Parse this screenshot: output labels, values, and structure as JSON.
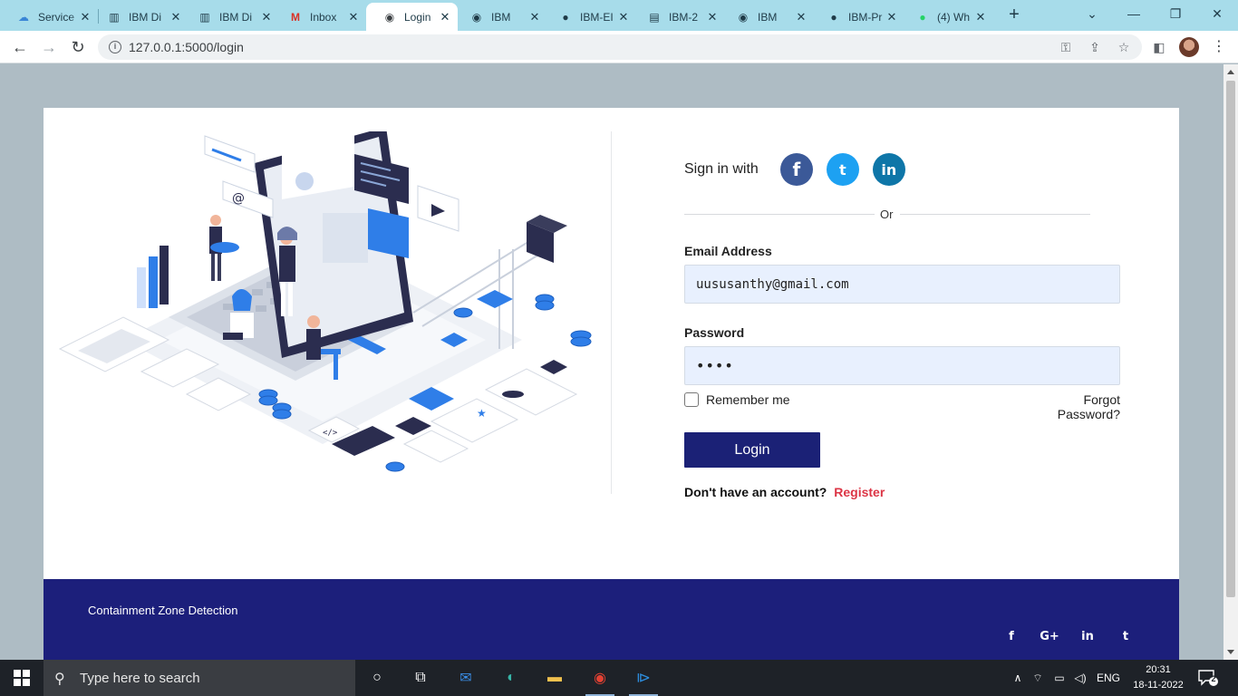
{
  "browser": {
    "tabs": [
      {
        "title": "Service",
        "icon": "cloud-icon",
        "active": false
      },
      {
        "title": "IBM Di",
        "icon": "grid-icon",
        "active": false
      },
      {
        "title": "IBM Di",
        "icon": "grid-icon",
        "active": false
      },
      {
        "title": "Inbox",
        "icon": "gmail-icon",
        "active": false
      },
      {
        "title": "Login",
        "icon": "globe-icon",
        "active": true
      },
      {
        "title": "IBM",
        "icon": "globe-icon",
        "active": false
      },
      {
        "title": "IBM-EI",
        "icon": "github-icon",
        "active": false
      },
      {
        "title": "IBM-2",
        "icon": "doc-icon",
        "active": false
      },
      {
        "title": "IBM",
        "icon": "globe-icon",
        "active": false
      },
      {
        "title": "IBM-Pr",
        "icon": "github-icon",
        "active": false
      },
      {
        "title": "(4) Wh",
        "icon": "whatsapp-icon",
        "active": false
      }
    ],
    "url": "127.0.0.1:5000/login"
  },
  "login": {
    "signin_label": "Sign in with",
    "or_text": "Or",
    "email_label": "Email Address",
    "email_value": "uususanthy@gmail.com",
    "password_label": "Password",
    "password_value": "••••",
    "remember_label": "Remember me",
    "forgot_label": "Forgot Password?",
    "login_button": "Login",
    "no_account_text": "Don't have an account?",
    "register_link": "Register"
  },
  "footer": {
    "brand": "Containment Zone Detection",
    "social": [
      "f",
      "G+",
      "in",
      "t"
    ]
  },
  "taskbar": {
    "search_placeholder": "Type here to search",
    "language": "ENG",
    "time": "20:31",
    "date": "18-11-2022",
    "notifications": "2"
  },
  "colors": {
    "footer_bg": "#1c1f7b",
    "login_button_bg": "#1b2176",
    "register_link": "#dc3545",
    "input_bg": "#e8f0fe",
    "facebook": "#3b5998",
    "twitter": "#1da1f2",
    "linkedin": "#0e76a8"
  }
}
